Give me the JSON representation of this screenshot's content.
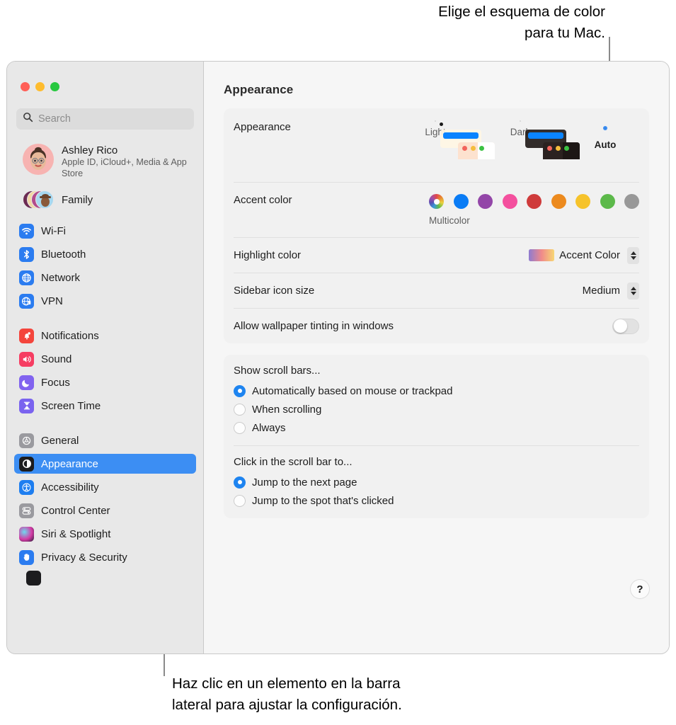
{
  "callouts": {
    "top": "Elige el esquema de color\npara tu Mac.",
    "bottom": "Haz clic en un elemento en la barra\nlateral para ajustar la configuración."
  },
  "window": {
    "title": "Appearance",
    "traffic_lights": [
      "close",
      "minimize",
      "zoom"
    ]
  },
  "sidebar": {
    "search": {
      "placeholder": "Search",
      "value": ""
    },
    "account": {
      "name": "Ashley Rico",
      "subtitle": "Apple ID, iCloud+, Media & App Store"
    },
    "family": {
      "label": "Family"
    },
    "groups": [
      {
        "items": [
          {
            "label": "Wi-Fi",
            "icon": "wifi-icon",
            "color": "#2b7cf0"
          },
          {
            "label": "Bluetooth",
            "icon": "bluetooth-icon",
            "color": "#2b7cf0"
          },
          {
            "label": "Network",
            "icon": "globe-icon",
            "color": "#2b7cf0"
          },
          {
            "label": "VPN",
            "icon": "vpn-globe-icon",
            "color": "#2b7cf0"
          }
        ]
      },
      {
        "items": [
          {
            "label": "Notifications",
            "icon": "bell-icon",
            "color": "#f4453c"
          },
          {
            "label": "Sound",
            "icon": "speaker-icon",
            "color": "#f63d62"
          },
          {
            "label": "Focus",
            "icon": "moon-icon",
            "color": "#8163ef"
          },
          {
            "label": "Screen Time",
            "icon": "hourglass-icon",
            "color": "#7a63ef"
          }
        ]
      },
      {
        "items": [
          {
            "label": "General",
            "icon": "gear-icon",
            "color": "#9a9a9f"
          },
          {
            "label": "Appearance",
            "icon": "appearance-icon",
            "color": "#1c1c1e",
            "selected": true
          },
          {
            "label": "Accessibility",
            "icon": "accessibility-icon",
            "color": "#1e7ef0"
          },
          {
            "label": "Control Center",
            "icon": "control-center-icon",
            "color": "#9a9a9f"
          },
          {
            "label": "Siri & Spotlight",
            "icon": "siri-icon",
            "color": "#2b1b3a"
          },
          {
            "label": "Privacy & Security",
            "icon": "hand-icon",
            "color": "#2b7cf0"
          }
        ]
      }
    ]
  },
  "main": {
    "appearance": {
      "label": "Appearance",
      "options": [
        {
          "label": "Light",
          "mode": "light",
          "selected": false
        },
        {
          "label": "Dark",
          "mode": "dark",
          "selected": false
        },
        {
          "label": "Auto",
          "mode": "auto",
          "selected": true
        }
      ]
    },
    "accent_color": {
      "label": "Accent color",
      "caption": "Multicolor",
      "swatches": [
        {
          "name": "multicolor",
          "color": "multicolor",
          "selected": true
        },
        {
          "name": "blue",
          "color": "#0a7cf5"
        },
        {
          "name": "purple",
          "color": "#9346a8"
        },
        {
          "name": "pink",
          "color": "#f martian"
        },
        {
          "name": "red",
          "color": "#cf3b3b"
        },
        {
          "name": "orange",
          "color": "#ec8a1e"
        },
        {
          "name": "yellow",
          "color": "#f6c32b"
        },
        {
          "name": "green",
          "color": "#5cb martian"
        },
        {
          "name": "graphite",
          "color": "#989898"
        }
      ]
    },
    "highlight_color": {
      "label": "Highlight color",
      "value": "Accent Color"
    },
    "sidebar_icon_size": {
      "label": "Sidebar icon size",
      "value": "Medium"
    },
    "wallpaper_tinting": {
      "label": "Allow wallpaper tinting in windows",
      "enabled": false
    },
    "scroll_bars": {
      "title": "Show scroll bars...",
      "options": [
        {
          "label": "Automatically based on mouse or trackpad",
          "selected": true
        },
        {
          "label": "When scrolling",
          "selected": false
        },
        {
          "label": "Always",
          "selected": false
        }
      ]
    },
    "scroll_click": {
      "title": "Click in the scroll bar to...",
      "options": [
        {
          "label": "Jump to the next page",
          "selected": true
        },
        {
          "label": "Jump to the spot that's clicked",
          "selected": false
        }
      ]
    },
    "help_button": "?"
  }
}
